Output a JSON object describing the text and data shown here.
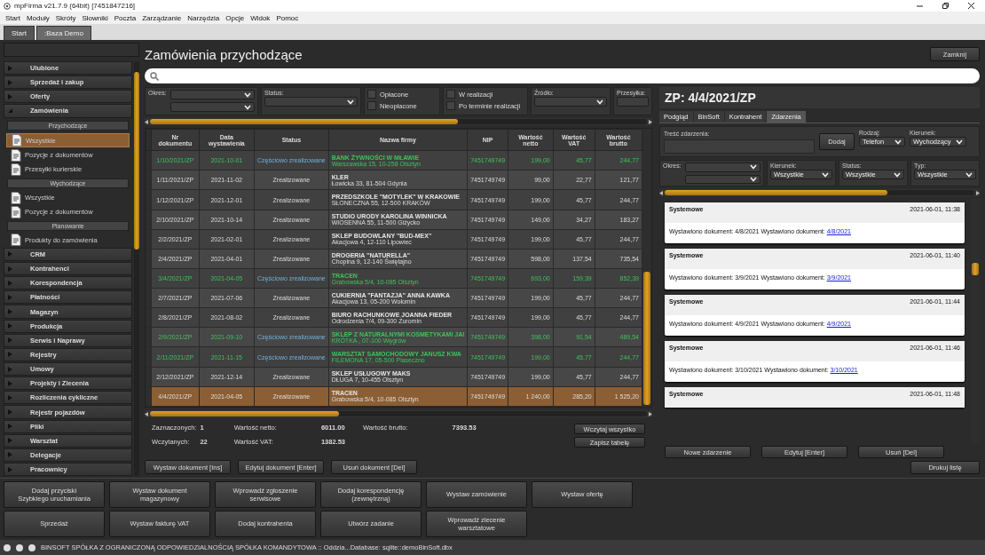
{
  "window": {
    "title": "mpFirma v21.7.9 (64bit) [7451847216]"
  },
  "menu": [
    "Start",
    "Moduły",
    "Skróty",
    "Słowniki",
    "Poczta",
    "Zarządzanie",
    "Narzędzia",
    "Opcje",
    "Widok",
    "Pomoc"
  ],
  "tabs": [
    {
      "label": "Start",
      "selected": false
    },
    {
      "label": ":Baza Demo",
      "selected": true
    }
  ],
  "sidebar": {
    "sections": [
      {
        "label": "Ulubione",
        "expanded": false
      },
      {
        "label": "Sprzedaż i zakup",
        "expanded": false
      },
      {
        "label": "Oferty",
        "expanded": false
      },
      {
        "label": "Zamówienia",
        "expanded": true,
        "groups": [
          {
            "label": "Przychodzące",
            "items": [
              {
                "label": "Wszystkie",
                "selected": true
              },
              {
                "label": "Pozycje z dokumentów",
                "selected": false
              },
              {
                "label": "Przesyłki kurierskie",
                "selected": false
              }
            ]
          },
          {
            "label": "Wychodzące",
            "items": [
              {
                "label": "Wszystkie",
                "selected": false
              },
              {
                "label": "Pozycje z dokumentów",
                "selected": false
              }
            ]
          },
          {
            "label": "Planowanie",
            "items": [
              {
                "label": "Produkty do zamówienia",
                "selected": false
              }
            ]
          }
        ]
      },
      {
        "label": "CRM",
        "expanded": false
      },
      {
        "label": "Kontrahenci",
        "expanded": false
      },
      {
        "label": "Korespondencja",
        "expanded": false
      },
      {
        "label": "Płatności",
        "expanded": false
      },
      {
        "label": "Magazyn",
        "expanded": false
      },
      {
        "label": "Produkcja",
        "expanded": false
      },
      {
        "label": "Serwis i Naprawy",
        "expanded": false
      },
      {
        "label": "Rejestry",
        "expanded": false
      },
      {
        "label": "Umowy",
        "expanded": false
      },
      {
        "label": "Projekty i Zlecenia",
        "expanded": false
      },
      {
        "label": "Rozliczenia cykliczne",
        "expanded": false
      },
      {
        "label": "Rejestr pojazdów",
        "expanded": false
      },
      {
        "label": "Pliki",
        "expanded": false
      },
      {
        "label": "Warsztat",
        "expanded": false
      },
      {
        "label": "Delegacje",
        "expanded": false
      },
      {
        "label": "Pracownicy",
        "expanded": false
      }
    ]
  },
  "page": {
    "title": "Zamówienia przychodzące",
    "close_button": "Zamknij"
  },
  "filters": {
    "period_label": "Okres:",
    "status_label": "Status:",
    "checkbox_groups": [
      {
        "items": [
          {
            "label": "Opłacone",
            "checked": false
          },
          {
            "label": "Nieopłacone",
            "checked": false
          }
        ]
      },
      {
        "items": [
          {
            "label": "W realizacji",
            "checked": false
          },
          {
            "label": "Po terminie realizacji",
            "checked": false
          }
        ]
      }
    ],
    "source_label": "Źródło:",
    "shipment_label": "Przesyłka:"
  },
  "table": {
    "columns": [
      "Nr dokumentu",
      "Data wystawienia",
      "Status",
      "Nazwa firmy",
      "NIP",
      "Wartość netto",
      "Wartość VAT",
      "Wartość brutto"
    ],
    "rows": [
      {
        "kind": "partial",
        "selected": false,
        "number": "1/10/2021/ZP",
        "date": "2021-10-01",
        "status": "Częściowo zrealizowane",
        "company": "BANK ŻYWNOŚCI W MŁAWIE",
        "address": "Warszawska 15, 10-258 Olsztyn",
        "nip": "7451749749",
        "net": "199,00",
        "vat": "45,77",
        "gross": "244,77"
      },
      {
        "kind": "done",
        "selected": false,
        "number": "1/11/2021/ZP",
        "date": "2021-11-02",
        "status": "Zrealizowane",
        "company": "KLER",
        "address": "Łowicka 33, 81-504 Gdynia",
        "nip": "7451749749",
        "net": "99,00",
        "vat": "22,77",
        "gross": "121,77"
      },
      {
        "kind": "done",
        "selected": false,
        "number": "1/12/2021/ZP",
        "date": "2021-12-01",
        "status": "Zrealizowane",
        "company": "PRZEDSZKOLE \"MOTYLEK\" W KRAKOWIE",
        "address": "SŁONECZNA 55, 12-500 KRAKÓW",
        "nip": "7451749749",
        "net": "199,00",
        "vat": "45,77",
        "gross": "244,77"
      },
      {
        "kind": "done",
        "selected": false,
        "number": "2/10/2021/ZP",
        "date": "2021-10-14",
        "status": "Zrealizowane",
        "company": "STUDIO URODY KAROLINA WINNICKA",
        "address": "WIOSENNA 55, 11-500 Giżycko",
        "nip": "7451749749",
        "net": "149,00",
        "vat": "34,27",
        "gross": "183,27"
      },
      {
        "kind": "done",
        "selected": false,
        "number": "2/2/2021/ZP",
        "date": "2021-02-01",
        "status": "Zrealizowane",
        "company": "SKLEP BUDOWLANY \"BUD-MEX\"",
        "address": "Akacjowa 4, 12-110 Lipowiec",
        "nip": "7451749749",
        "net": "199,00",
        "vat": "45,77",
        "gross": "244,77"
      },
      {
        "kind": "done",
        "selected": false,
        "number": "2/4/2021/ZP",
        "date": "2021-04-01",
        "status": "Zrealizowane",
        "company": "DROGERIA \"NATURELLA\"",
        "address": "Chopina 9, 12-140 Świętajno",
        "nip": "7451749749",
        "net": "598,00",
        "vat": "137,54",
        "gross": "735,54"
      },
      {
        "kind": "partial",
        "selected": false,
        "number": "3/4/2021/ZP",
        "date": "2021-04-05",
        "status": "Częściowo zrealizowane",
        "company": "TRACEN",
        "address": "Grabowska 5/4, 10-085 Olsztyn",
        "nip": "7451749749",
        "net": "693,00",
        "vat": "159,39",
        "gross": "852,39"
      },
      {
        "kind": "done",
        "selected": false,
        "number": "2/7/2021/ZP",
        "date": "2021-07-06",
        "status": "Zrealizowane",
        "company": "CUKIERNIA \"FANTAZJA\" ANNA KAWKA",
        "address": "Akacjowa 13, 05-200 Wołomin",
        "nip": "7451749749",
        "net": "199,00",
        "vat": "45,77",
        "gross": "244,77"
      },
      {
        "kind": "done",
        "selected": false,
        "number": "2/8/2021/ZP",
        "date": "2021-08-02",
        "status": "Zrealizowane",
        "company": "BIURO RACHUNKOWE JOANNA FIEDER",
        "address": "Odrodzenia 7/4, 09-300 Żuromin",
        "nip": "7451749749",
        "net": "199,00",
        "vat": "45,77",
        "gross": "244,77"
      },
      {
        "kind": "partial",
        "selected": false,
        "number": "2/9/2021/ZP",
        "date": "2021-09-10",
        "status": "Częściowo zrealizowane",
        "company": "SKLEP Z NATURALNYMI KOSMETYKAMI JAI",
        "address": "KRÓTKA , 07-100 Węgrów",
        "nip": "7451749749",
        "net": "398,00",
        "vat": "91,54",
        "gross": "489,54"
      },
      {
        "kind": "partial",
        "selected": false,
        "number": "2/11/2021/ZP",
        "date": "2021-11-15",
        "status": "Częściowo zrealizowane",
        "company": "WARSZTAT SAMOCHODOWY JANUSZ KWA",
        "address": "FILEMONA 17, 05-500 Piaseczno",
        "nip": "7451749749",
        "net": "199,00",
        "vat": "45,77",
        "gross": "244,77"
      },
      {
        "kind": "done",
        "selected": false,
        "number": "2/12/2021/ZP",
        "date": "2021-12-14",
        "status": "Zrealizowane",
        "company": "SKLEP USŁUGOWY MAKS",
        "address": "DŁUGA 7, 10-455 Olsztyn",
        "nip": "7451749749",
        "net": "199,00",
        "vat": "45,77",
        "gross": "244,77"
      },
      {
        "kind": "done",
        "selected": true,
        "number": "4/4/2021/ZP",
        "date": "2021-04-05",
        "status": "Zrealizowane",
        "company": "TRACEN",
        "address": "Grabowska 5/4, 10-085 Olsztyn",
        "nip": "7451749749",
        "net": "1 240,00",
        "vat": "285,20",
        "gross": "1 525,20"
      }
    ]
  },
  "summary": {
    "selected_label": "Zaznaczonych:",
    "selected_count": "1",
    "loaded_label": "Wczytanych:",
    "loaded_count": "22",
    "net_label": "Wartość netto:",
    "net": "6011.00",
    "vat_label": "Wartość VAT:",
    "vat": "1382.53",
    "gross_label": "Wartość brutto:",
    "gross": "7393.53",
    "buttons": [
      "Wczytaj wszystko",
      "Zapisz tabelę"
    ]
  },
  "document_buttons": [
    "Wystaw dokument [Ins]",
    "Edytuj dokument [Enter]",
    "Usuń dokument [Del]"
  ],
  "detail": {
    "title": "ZP: 4/4/2021/ZP",
    "tabs": [
      {
        "label": "Podgląd",
        "selected": false
      },
      {
        "label": "BinSoft",
        "selected": false
      },
      {
        "label": "Kontrahent",
        "selected": false
      },
      {
        "label": "Zdarzenia",
        "selected": true
      }
    ],
    "event_form": {
      "content_label": "Treść zdarzenia:",
      "add_button": "Dodaj",
      "type_label": "Rodzaj:",
      "type": "Telefon",
      "direction_label": "Kierunek:",
      "direction": "Wychodzący"
    },
    "filters": {
      "period_label": "Okres:",
      "direction_label": "Kierunek:",
      "direction": "Wszystkie",
      "status_label": "Status:",
      "status": "Wszystkie",
      "type_label": "Typ:",
      "type": "Wszystkie"
    },
    "events": [
      {
        "category": "Systemowe",
        "time": "2021-06-01, 11:38",
        "text": "Wystawiono dokument: 4/8/2021 Wystawiono dokument:",
        "link": "4/8/2021"
      },
      {
        "category": "Systemowe",
        "time": "2021-06-01, 11:40",
        "text": "Wystawiono dokument: 3/9/2021 Wystawiono dokument:",
        "link": "3/9/2021"
      },
      {
        "category": "Systemowe",
        "time": "2021-06-01, 11:44",
        "text": "Wystawiono dokument: 4/9/2021 Wystawiono dokument:",
        "link": "4/9/2021"
      },
      {
        "category": "Systemowe",
        "time": "2021-06-01, 11:46",
        "text": "Wystawiono dokument: 3/10/2021 Wystawiono dokument:",
        "link": "3/10/2021"
      },
      {
        "category": "Systemowe",
        "time": "2021-06-01, 11:48"
      }
    ],
    "buttons": [
      "Nowe zdarzenie",
      "Edytuj [Enter]",
      "Usuń [Del]"
    ]
  },
  "print_button": "Drukuj listę",
  "quick_buttons": [
    [
      "Dodaj przyciski\nSzybkiego uruchamiania",
      "Wystaw dokument\nmagazynowy",
      "Wprowadź zgłoszenie\nserwisowe",
      "Dodaj korespondencję\n(zewnętrzną)",
      "Wystaw zamówienie",
      "Wystaw ofertę"
    ],
    [
      "Sprzedaż",
      "Wystaw fakturę VAT",
      "Dodaj kontrahenta",
      "Utwórz zadanie",
      "Wprowadź zlecenie\nwarsztatowe"
    ]
  ],
  "status_bar": {
    "text": "BINSOFT SPÓŁKA Z OGRANICZONĄ ODPOWIEDZIALNOŚCIĄ SPÓŁKA KOMANDYTOWA :: Oddzia...Database: sqlite::demoBinSoft.dbx"
  }
}
